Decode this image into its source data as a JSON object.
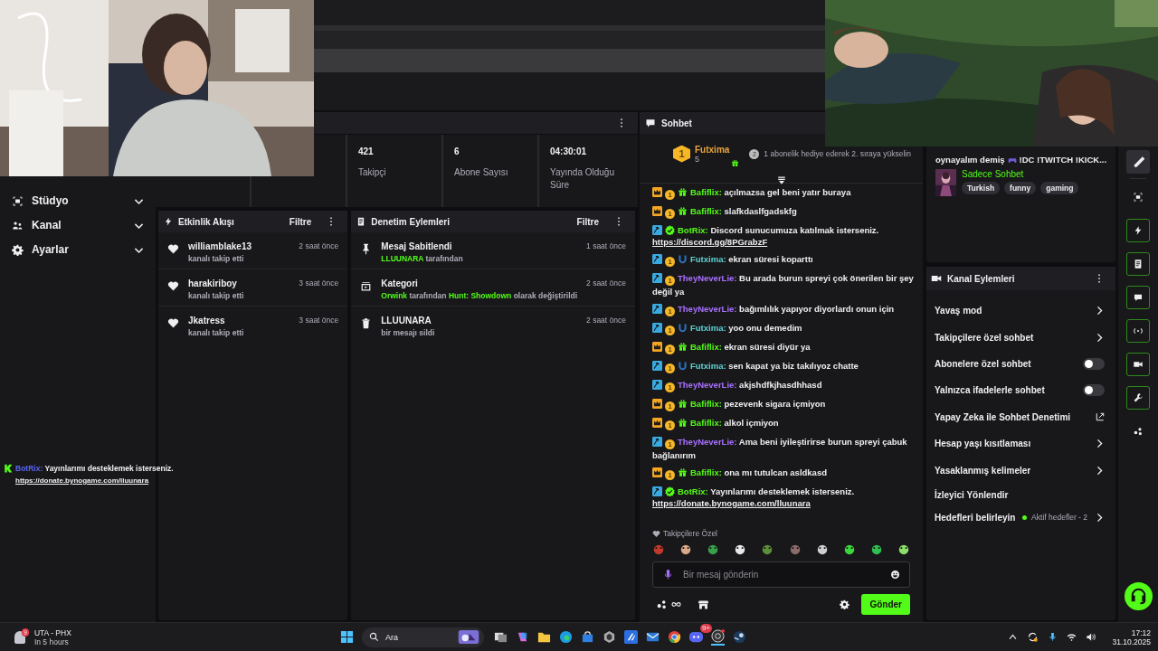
{
  "sidebar": {
    "items": [
      {
        "label": "Stüdyo",
        "expanded": false
      },
      {
        "label": "Kanal",
        "expanded": false
      },
      {
        "label": "Ayarlar",
        "expanded": false
      }
    ],
    "chat_message": {
      "user": "BotRix:",
      "text": "Yayınlarımı desteklemek isterseniz.",
      "link": "https://donate.bynogame.com/lluunara"
    }
  },
  "stats": [
    {
      "value": "421",
      "label": "Takipçi"
    },
    {
      "value": "6",
      "label": "Abone Sayısı"
    },
    {
      "value": "04:30:01",
      "label": "Yayında Olduğu Süre"
    }
  ],
  "event_feed": {
    "title": "Etkinlik Akışı",
    "filter": "Filtre",
    "items": [
      {
        "name": "williamblake13",
        "detail": "kanalı takip etti",
        "time": "2 saat önce"
      },
      {
        "name": "harakiriboy",
        "detail": "kanalı takip etti",
        "time": "3 saat önce"
      },
      {
        "name": "Jkatress",
        "detail": "kanalı takip etti",
        "time": "3 saat önce"
      }
    ]
  },
  "mod_actions": {
    "title": "Denetim Eylemleri",
    "filter": "Filtre",
    "items": [
      {
        "kind": "pin",
        "title": "Mesaj Sabitlendi",
        "time": "1 saat önce",
        "detail": [
          {
            "text": "LLUUNARA",
            "highlight": true
          },
          {
            "text": " tarafından",
            "highlight": false
          }
        ]
      },
      {
        "kind": "category",
        "title": "Kategori",
        "time": "2 saat önce",
        "detail": [
          {
            "text": "Orwink",
            "highlight": true
          },
          {
            "text": " tarafından ",
            "highlight": false
          },
          {
            "text": "Hunt: Showdown",
            "highlight": true
          },
          {
            "text": " olarak değiştirildi",
            "highlight": false
          }
        ]
      },
      {
        "kind": "delete",
        "title": "LLUUNARA",
        "time": "2 saat önce",
        "detail": [
          {
            "text": "bir mesajı sildi",
            "highlight": false
          }
        ]
      }
    ]
  },
  "chat": {
    "title": "Sohbet",
    "leader": {
      "rank": "1",
      "name": "Futxima",
      "count": "5",
      "next_rank": "2",
      "note": "1 abonelik hediye ederek 2. sıraya yükselin"
    },
    "messages": [
      {
        "badges": [
          {
            "kind": "crown"
          },
          {
            "kind": "coin",
            "label": "1"
          },
          {
            "kind": "gift"
          }
        ],
        "user": "Bafiflix:",
        "color": "#53fc18",
        "text": "açılmazsa gel beni yatır buraya"
      },
      {
        "badges": [
          {
            "kind": "crown"
          },
          {
            "kind": "coin",
            "label": "1"
          },
          {
            "kind": "gift"
          }
        ],
        "user": "Bafiflix:",
        "color": "#53fc18",
        "text": "slafkdaslfgadskfg"
      },
      {
        "badges": [
          {
            "kind": "hammer"
          },
          {
            "kind": "verified"
          }
        ],
        "user": "BotRix:",
        "color": "#53fc18",
        "text": "Discord sunucumuza katılmak isterseniz.",
        "link": "https://discord.gg/8PGrabzF"
      },
      {
        "badges": [
          {
            "kind": "hammer"
          },
          {
            "kind": "coin",
            "label": "1"
          },
          {
            "kind": "shield"
          }
        ],
        "user": "Futxima:",
        "color": "#5fd3d3",
        "text": "ekran süresi koparttı"
      },
      {
        "badges": [
          {
            "kind": "hammer"
          },
          {
            "kind": "coin",
            "label": "1"
          }
        ],
        "user": "TheyNeverLie:",
        "color": "#a970ff",
        "text": "Bu arada burun spreyi çok önerilen bir şey değil ya"
      },
      {
        "badges": [
          {
            "kind": "hammer"
          },
          {
            "kind": "coin",
            "label": "1"
          }
        ],
        "user": "TheyNeverLie:",
        "color": "#a970ff",
        "text": "bağımlılık yapıyor diyorlardı onun için"
      },
      {
        "badges": [
          {
            "kind": "hammer"
          },
          {
            "kind": "coin",
            "label": "1"
          },
          {
            "kind": "shield"
          }
        ],
        "user": "Futxima:",
        "color": "#5fd3d3",
        "text": "yoo onu demedim"
      },
      {
        "badges": [
          {
            "kind": "crown"
          },
          {
            "kind": "coin",
            "label": "1"
          },
          {
            "kind": "gift"
          }
        ],
        "user": "Bafiflix:",
        "color": "#53fc18",
        "text": "ekran süresi diyür ya"
      },
      {
        "badges": [
          {
            "kind": "hammer"
          },
          {
            "kind": "coin",
            "label": "1"
          },
          {
            "kind": "shield"
          }
        ],
        "user": "Futxima:",
        "color": "#5fd3d3",
        "text": "sen kapat ya biz takılıyoz chatte"
      },
      {
        "badges": [
          {
            "kind": "hammer"
          },
          {
            "kind": "coin",
            "label": "1"
          }
        ],
        "user": "TheyNeverLie:",
        "color": "#a970ff",
        "text": "akjshdfkjhasdhhasd"
      },
      {
        "badges": [
          {
            "kind": "crown"
          },
          {
            "kind": "coin",
            "label": "1"
          },
          {
            "kind": "gift"
          }
        ],
        "user": "Bafiflix:",
        "color": "#53fc18",
        "text": "pezevenk sigara içmiyon"
      },
      {
        "badges": [
          {
            "kind": "crown"
          },
          {
            "kind": "coin",
            "label": "1"
          },
          {
            "kind": "gift"
          }
        ],
        "user": "Bafiflix:",
        "color": "#53fc18",
        "text": "alkol içmiyon"
      },
      {
        "badges": [
          {
            "kind": "hammer"
          },
          {
            "kind": "coin",
            "label": "1"
          }
        ],
        "user": "TheyNeverLie:",
        "color": "#a970ff",
        "text": "Ama beni iyileştirirse burun spreyi çabuk bağlanırım"
      },
      {
        "badges": [
          {
            "kind": "crown"
          },
          {
            "kind": "coin",
            "label": "1"
          },
          {
            "kind": "gift"
          }
        ],
        "user": "Bafiflix:",
        "color": "#53fc18",
        "text": "ona mı tutulcan asldkasd"
      },
      {
        "badges": [
          {
            "kind": "hammer"
          },
          {
            "kind": "verified"
          }
        ],
        "user": "BotRix:",
        "color": "#53fc18",
        "text": "Yayınlarımı desteklemek isterseniz.",
        "link": "https://donate.bynogame.com/lluunara"
      }
    ],
    "followers_only": "Takipçilere Özel",
    "input": {
      "placeholder": "Bir mesaj gönderin"
    },
    "send": "Gönder"
  },
  "stream_info": {
    "title_start": "oynayalım demiş",
    "title_end": "!DC !TWITCH !KICK...",
    "category": "Sadece Sohbet",
    "tags": [
      "Turkish",
      "funny",
      "gaming"
    ]
  },
  "channel_actions": {
    "title": "Kanal Eylemleri",
    "items": [
      {
        "kind": "link",
        "label": "Yavaş mod"
      },
      {
        "kind": "link",
        "label": "Takipçilere özel sohbet"
      },
      {
        "kind": "toggle",
        "label": "Abonelere özel sohbet",
        "on": false
      },
      {
        "kind": "toggle",
        "label": "Yalnızca ifadelerle sohbet",
        "on": false
      },
      {
        "kind": "external",
        "label": "Yapay Zeka ile Sohbet Denetimi"
      },
      {
        "kind": "link",
        "label": "Hesap yaşı kısıtlaması"
      },
      {
        "kind": "link",
        "label": "Yasaklanmış kelimeler"
      },
      {
        "kind": "plain",
        "label": "İzleyici Yönlendir"
      },
      {
        "kind": "goal",
        "label": "Hedefleri belirleyin",
        "status": "Aktif hedefler - 2"
      }
    ]
  },
  "taskbar": {
    "weather": {
      "badge": "9",
      "place": "UTA - PHX",
      "when": "In 5 hours"
    },
    "search": "Ara",
    "discord_badge": "9+",
    "time": "17:12",
    "date": "31.10.2025"
  }
}
